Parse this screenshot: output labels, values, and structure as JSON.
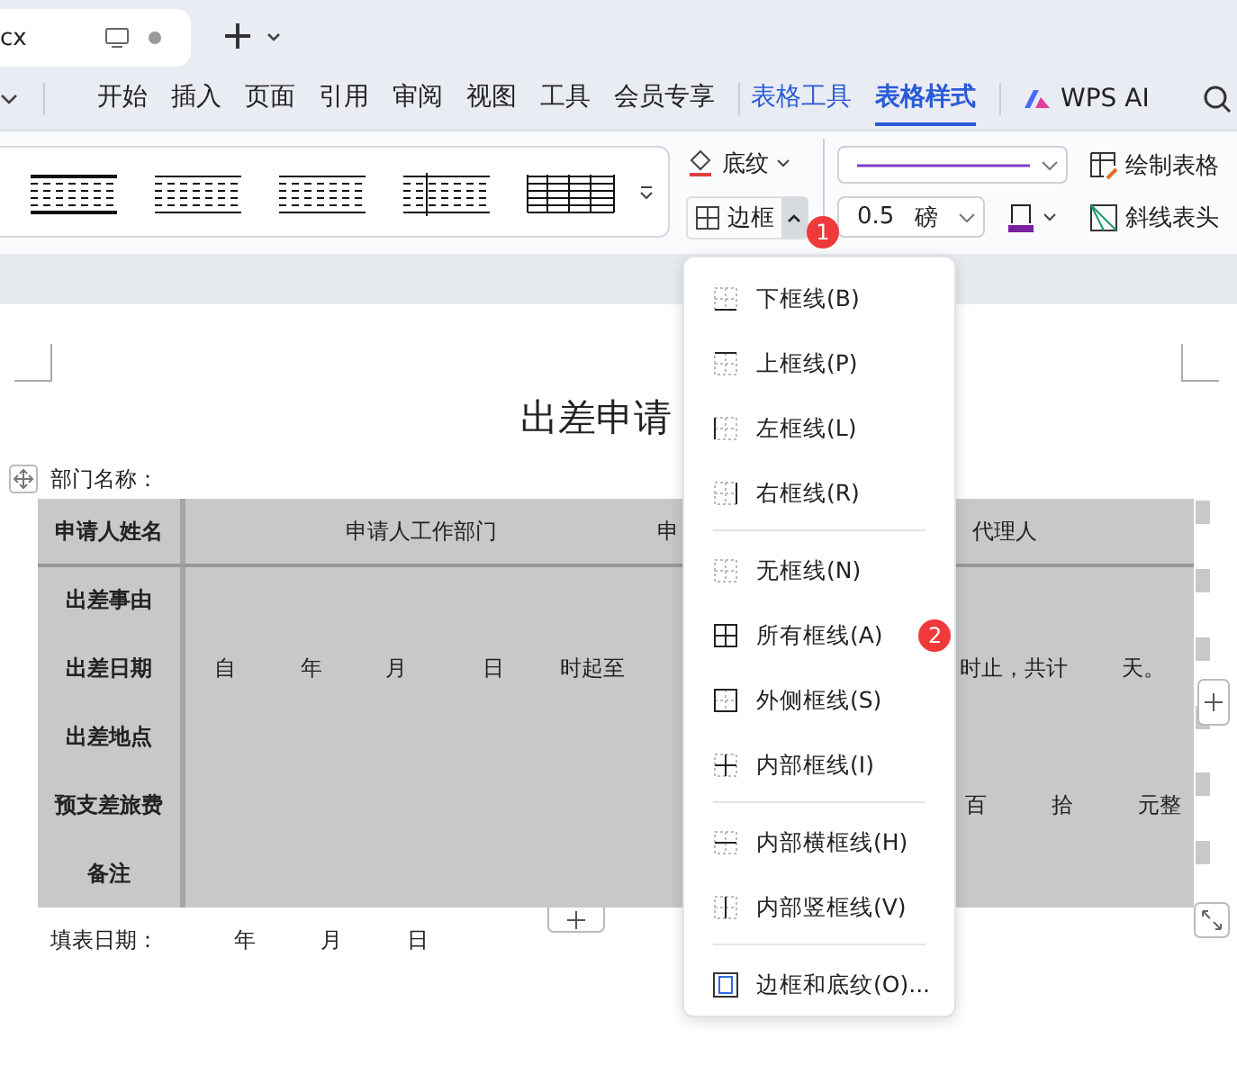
{
  "tabs": [
    {
      "label": "cx",
      "selected": true
    }
  ],
  "menu_tabs": [
    {
      "label": "开始",
      "kind": "normal",
      "selected": false
    },
    {
      "label": "插入",
      "kind": "normal",
      "selected": false
    },
    {
      "label": "页面",
      "kind": "normal",
      "selected": false
    },
    {
      "label": "引用",
      "kind": "normal",
      "selected": false
    },
    {
      "label": "审阅",
      "kind": "normal",
      "selected": false
    },
    {
      "label": "视图",
      "kind": "normal",
      "selected": false
    },
    {
      "label": "工具",
      "kind": "normal",
      "selected": false
    },
    {
      "label": "会员专享",
      "kind": "normal",
      "selected": false
    },
    {
      "label": "表格工具",
      "kind": "context",
      "selected": false
    },
    {
      "label": "表格样式",
      "kind": "context",
      "selected": true
    }
  ],
  "ai_button": "WPS AI",
  "ribbon": {
    "shading": "底纹",
    "border": "边框",
    "border_open": true,
    "border_badge": "1",
    "line_weight": "0.5",
    "unit": "磅",
    "draw_table": "绘制表格",
    "diagonal_header": "斜线表头"
  },
  "border_menu": {
    "groups": [
      [
        {
          "label": "下框线(B)",
          "kind": "bottom"
        },
        {
          "label": "上框线(P)",
          "kind": "top"
        },
        {
          "label": "左框线(L)",
          "kind": "left"
        },
        {
          "label": "右框线(R)",
          "kind": "right"
        }
      ],
      [
        {
          "label": "无框线(N)",
          "kind": "none"
        },
        {
          "label": "所有框线(A)",
          "kind": "all",
          "badge": "2"
        },
        {
          "label": "外侧框线(S)",
          "kind": "outside"
        },
        {
          "label": "内部框线(I)",
          "kind": "inside"
        }
      ],
      [
        {
          "label": "内部横框线(H)",
          "kind": "inside_h"
        },
        {
          "label": "内部竖框线(V)",
          "kind": "inside_v"
        }
      ],
      [
        {
          "label": "边框和底纹(O)...",
          "kind": "dialog"
        }
      ]
    ]
  },
  "document": {
    "title": "出差申请",
    "department_label": "部门名称：",
    "table": {
      "rows": [
        {
          "kind": "header",
          "label": "申请人姓名",
          "cells": [
            "申请人工作部门",
            "申",
            "代理人"
          ]
        },
        {
          "kind": "blank",
          "label": "出差事由"
        },
        {
          "kind": "dates",
          "label": "出差日期",
          "cells": [
            "自",
            "年",
            "月",
            "日",
            "时起至",
            "时止，共计",
            "天。"
          ]
        },
        {
          "kind": "blank",
          "label": "出差地点"
        },
        {
          "kind": "money",
          "label": "预支差旅费",
          "cells": [
            "百",
            "拾",
            "元整"
          ]
        },
        {
          "kind": "blank",
          "label": "备注"
        }
      ]
    },
    "fill_date": {
      "label": "填表日期：",
      "parts": [
        "年",
        "月",
        "日"
      ]
    }
  }
}
